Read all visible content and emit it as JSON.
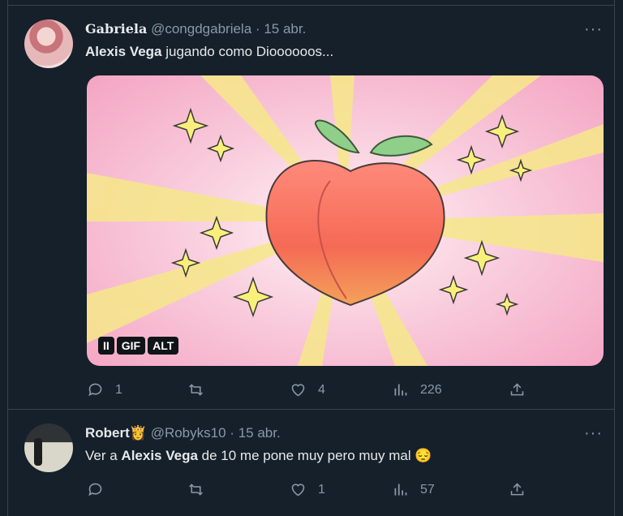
{
  "tweets": [
    {
      "name": "Gabriela",
      "handle": "@congdgabriela",
      "separator": "·",
      "date": "15 abr.",
      "text_bold": "Alexis Vega",
      "text_rest": " jugando como Dioooooos...",
      "media": {
        "type": "GIF",
        "pause_label": "II",
        "gif_label": "GIF",
        "alt_label": "ALT"
      },
      "actions": {
        "replies": "1",
        "retweets": "",
        "likes": "4",
        "views": "226"
      }
    },
    {
      "name": "Robert",
      "name_emoji": "👸",
      "handle": "@Robyks10",
      "separator": "·",
      "date": "15 abr.",
      "text_pre": "Ver a ",
      "text_bold": "Alexis Vega",
      "text_rest": " de 10 me pone muy pero muy mal",
      "text_emoji": "😔",
      "actions": {
        "replies": "",
        "retweets": "",
        "likes": "1",
        "views": "57"
      }
    }
  ],
  "more_label": "···",
  "colors": {
    "background": "#15202b",
    "border": "#38444d",
    "muted": "#8b98a5",
    "text": "#e7e9ea"
  },
  "icons": [
    "reply-icon",
    "retweet-icon",
    "like-icon",
    "views-icon",
    "share-icon",
    "more-icon"
  ]
}
